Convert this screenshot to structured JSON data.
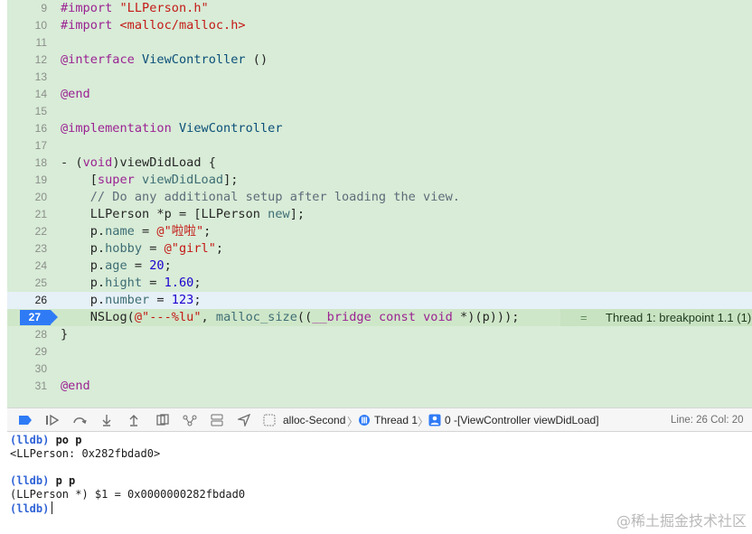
{
  "editor": {
    "lines": [
      {
        "num": "9",
        "tokens": [
          [
            "#import ",
            "pl"
          ],
          [
            "\"LLPerson.h\"",
            "s"
          ]
        ]
      },
      {
        "num": "10",
        "tokens": [
          [
            "#import ",
            "pl"
          ],
          [
            "<malloc/malloc.h>",
            "s"
          ]
        ]
      },
      {
        "num": "11",
        "tokens": []
      },
      {
        "num": "12",
        "tokens": [
          [
            "@interface ",
            "k"
          ],
          [
            "ViewController",
            "t"
          ],
          [
            " ()",
            ""
          ]
        ]
      },
      {
        "num": "13",
        "tokens": []
      },
      {
        "num": "14",
        "tokens": [
          [
            "@end",
            "k"
          ]
        ]
      },
      {
        "num": "15",
        "tokens": []
      },
      {
        "num": "16",
        "tokens": [
          [
            "@implementation ",
            "k"
          ],
          [
            "ViewController",
            "t"
          ]
        ]
      },
      {
        "num": "17",
        "tokens": []
      },
      {
        "num": "18",
        "tokens": [
          [
            "- (",
            ""
          ],
          [
            "void",
            "k"
          ],
          [
            ")viewDidLoad {",
            ""
          ]
        ]
      },
      {
        "num": "19",
        "tokens": [
          [
            "    [",
            ""
          ],
          [
            "super",
            "k"
          ],
          [
            " ",
            ""
          ],
          [
            "viewDidLoad",
            "p"
          ],
          [
            "];",
            ""
          ]
        ]
      },
      {
        "num": "20",
        "tokens": [
          [
            "    // Do any additional setup after loading the view.",
            "c"
          ]
        ]
      },
      {
        "num": "21",
        "tokens": [
          [
            "    LLPerson *p = [LLPerson ",
            ""
          ],
          [
            "new",
            "p"
          ],
          [
            "];",
            ""
          ]
        ]
      },
      {
        "num": "22",
        "tokens": [
          [
            "    p.",
            ""
          ],
          [
            "name",
            "p"
          ],
          [
            " = ",
            ""
          ],
          [
            "@\"啦啦\"",
            "s"
          ],
          [
            ";",
            ""
          ]
        ]
      },
      {
        "num": "23",
        "tokens": [
          [
            "    p.",
            ""
          ],
          [
            "hobby",
            "p"
          ],
          [
            " = ",
            ""
          ],
          [
            "@\"girl\"",
            "s"
          ],
          [
            ";",
            ""
          ]
        ]
      },
      {
        "num": "24",
        "tokens": [
          [
            "    p.",
            ""
          ],
          [
            "age",
            "p"
          ],
          [
            " = ",
            ""
          ],
          [
            "20",
            "n"
          ],
          [
            ";",
            ""
          ]
        ]
      },
      {
        "num": "25",
        "tokens": [
          [
            "    p.",
            ""
          ],
          [
            "hight",
            "p"
          ],
          [
            " = ",
            ""
          ],
          [
            "1.60",
            "n"
          ],
          [
            ";",
            ""
          ]
        ]
      },
      {
        "num": "26",
        "tokens": [
          [
            "    p.",
            ""
          ],
          [
            "number",
            "p"
          ],
          [
            " = ",
            ""
          ],
          [
            "123",
            "n"
          ],
          [
            ";",
            ""
          ]
        ],
        "current": true
      },
      {
        "num": "27",
        "tokens": [
          [
            "    NSLog(",
            ""
          ],
          [
            "@\"---%lu\"",
            "s"
          ],
          [
            ", ",
            ""
          ],
          [
            "malloc_size",
            "p"
          ],
          [
            "((",
            ""
          ],
          [
            "__bridge",
            "k"
          ],
          [
            " ",
            ""
          ],
          [
            "const",
            "k"
          ],
          [
            " ",
            ""
          ],
          [
            "void",
            "k"
          ],
          [
            " *)(p)));",
            ""
          ]
        ],
        "breakpoint": true
      },
      {
        "num": "28",
        "tokens": [
          [
            "}",
            ""
          ]
        ]
      },
      {
        "num": "29",
        "tokens": []
      },
      {
        "num": "30",
        "tokens": []
      },
      {
        "num": "31",
        "tokens": [
          [
            "@end",
            "k"
          ]
        ]
      }
    ],
    "breakpoint_annotation": {
      "separator": "=",
      "text": "Thread 1: breakpoint 1.1 (1)"
    }
  },
  "debug_bar": {
    "process": "alloc-Second",
    "thread": "Thread 1",
    "frame": "0 -[ViewController viewDidLoad]",
    "position": "Line: 26  Col: 20",
    "icons": [
      "breakpoints-toggle-icon",
      "continue-icon",
      "step-over-icon",
      "step-into-icon",
      "step-out-icon",
      "view-debugger-icon",
      "memory-graph-icon",
      "environment-icon",
      "location-icon"
    ]
  },
  "console": {
    "prompt": "(lldb)",
    "lines": [
      {
        "kind": "cmd",
        "text": "po p"
      },
      {
        "kind": "out",
        "text": "<LLPerson: 0x282fbdad0>"
      },
      {
        "kind": "blank",
        "text": ""
      },
      {
        "kind": "cmd",
        "text": "p p"
      },
      {
        "kind": "out",
        "text": "(LLPerson *) $1 = 0x0000000282fbdad0"
      },
      {
        "kind": "input",
        "text": ""
      }
    ]
  },
  "watermark": "@稀土掘金技术社区",
  "colors": {
    "editor_bg": "#d8ecd7",
    "breakpoint_blue": "#2f7bf6",
    "current_line": "#e6f0f7"
  }
}
